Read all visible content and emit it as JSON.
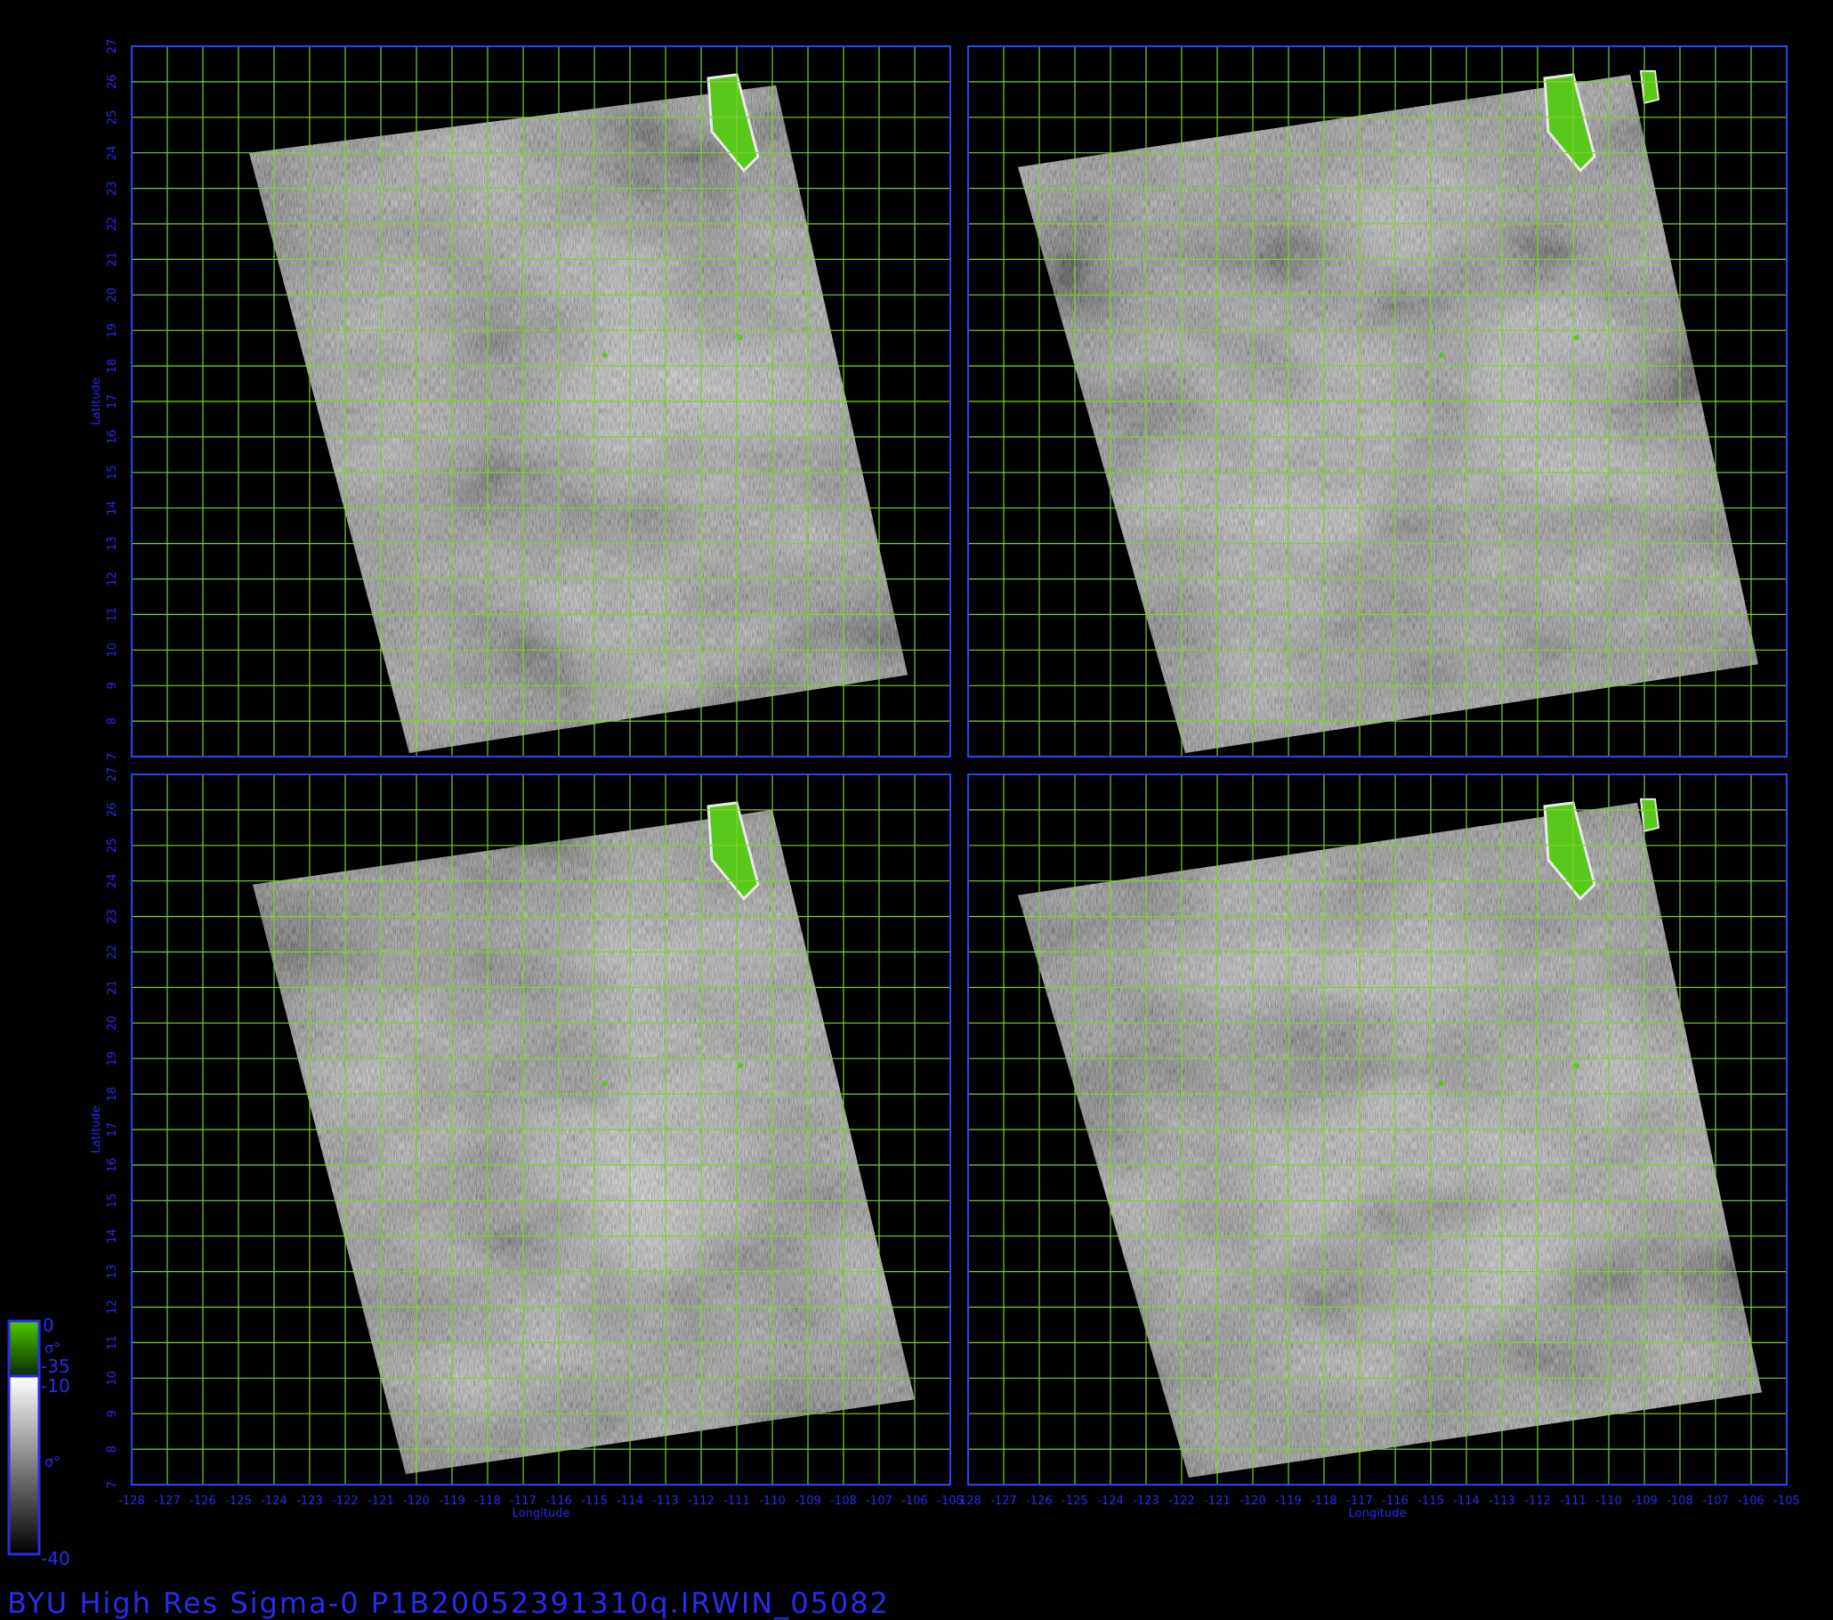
{
  "title": "BYU High Res Sigma-0 P1B20052391310q.IRWIN_05082",
  "axes": {
    "xlabel": "Longitude",
    "ylabel": "Latitude",
    "lon_range": [
      -128,
      -105
    ],
    "lat_range": [
      7,
      27
    ],
    "lon_ticks": [
      "-128",
      "-127",
      "-126",
      "-125",
      "-124",
      "-123",
      "-122",
      "-121",
      "-120",
      "-119",
      "-118",
      "-117",
      "-116",
      "-115",
      "-114",
      "-113",
      "-112",
      "-111",
      "-110",
      "-109",
      "-108",
      "-107",
      "-106",
      "-105"
    ],
    "lat_ticks": [
      "7",
      "8",
      "9",
      "10",
      "11",
      "12",
      "13",
      "14",
      "15",
      "16",
      "17",
      "18",
      "19",
      "20",
      "21",
      "22",
      "23",
      "24",
      "25",
      "26",
      "27"
    ]
  },
  "colorbar": {
    "land": {
      "top": "0",
      "bottom": "-35",
      "symbol": "σ°",
      "color_top": "#4ccc00",
      "color_bottom": "#0a2a00"
    },
    "ocean": {
      "top": "-10",
      "bottom": "-40",
      "symbol": "σ°",
      "color_top": "#ffffff",
      "color_bottom": "#000000"
    }
  },
  "colors": {
    "frame": "#1c4cff",
    "grid": "#7fd12a",
    "tick_text": "#2a2af0",
    "land": "#58c81a"
  },
  "panels": [
    {
      "id": "top-left"
    },
    {
      "id": "top-right"
    },
    {
      "id": "bottom-left"
    },
    {
      "id": "bottom-right"
    }
  ]
}
